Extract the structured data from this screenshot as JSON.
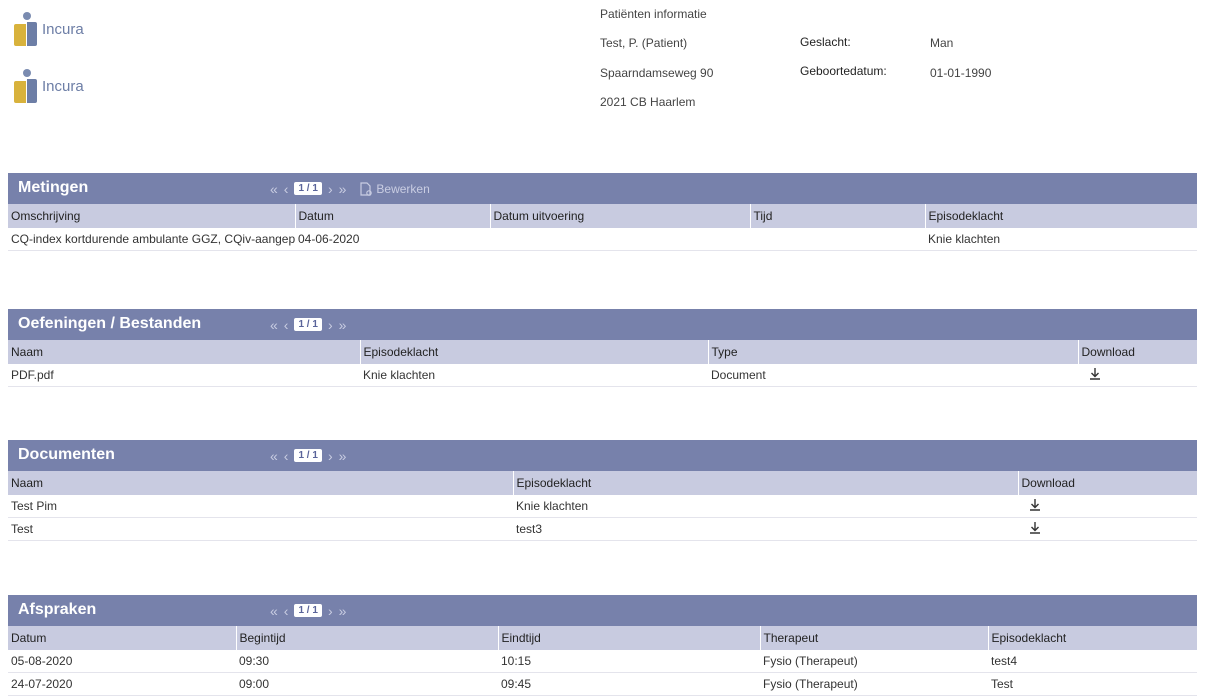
{
  "logo": {
    "text": "Incura"
  },
  "patient": {
    "heading": "Patiënten informatie",
    "name": "Test, P. (Patient)",
    "address": "Spaarndamseweg 90",
    "city": "2021 CB Haarlem",
    "gender_label": "Geslacht:",
    "gender_value": "Man",
    "dob_label": "Geboortedatum:",
    "dob_value": "01-01-1990"
  },
  "pager": {
    "first": "«",
    "prev": "‹",
    "page": "1 / 1",
    "next": "›",
    "last": "»"
  },
  "metingen": {
    "title": "Metingen",
    "edit_label": "Bewerken",
    "columns": [
      "Omschrijving",
      "Datum",
      "Datum uitvoering",
      "Tijd",
      "Episodeklacht"
    ],
    "rows": [
      [
        "CQ-index kortdurende ambulante GGZ, CQiv-aangepast",
        "04-06-2020",
        "",
        "",
        "Knie klachten"
      ]
    ]
  },
  "oefeningen": {
    "title": "Oefeningen / Bestanden",
    "columns": [
      "Naam",
      "Episodeklacht",
      "Type",
      "Download"
    ],
    "rows": [
      [
        "PDF.pdf",
        "Knie klachten",
        "Document"
      ]
    ]
  },
  "documenten": {
    "title": "Documenten",
    "columns": [
      "Naam",
      "Episodeklacht",
      "Download"
    ],
    "rows": [
      [
        "Test Pim",
        "Knie klachten"
      ],
      [
        "Test",
        "test3"
      ]
    ]
  },
  "afspraken": {
    "title": "Afspraken",
    "columns": [
      "Datum",
      "Begintijd",
      "Eindtijd",
      "Therapeut",
      "Episodeklacht"
    ],
    "rows": [
      [
        "05-08-2020",
        "09:30",
        "10:15",
        "Fysio (Therapeut)",
        "test4"
      ],
      [
        "24-07-2020",
        "09:00",
        "09:45",
        "Fysio (Therapeut)",
        "Test"
      ]
    ]
  },
  "icons": {
    "download": "download-arrow-icon",
    "edit": "document-edit-icon"
  },
  "colors": {
    "header_bar": "#7781ab",
    "column_header": "#c8cbe0",
    "brand_gold": "#d8b23c",
    "brand_blue": "#6d7ea6"
  }
}
